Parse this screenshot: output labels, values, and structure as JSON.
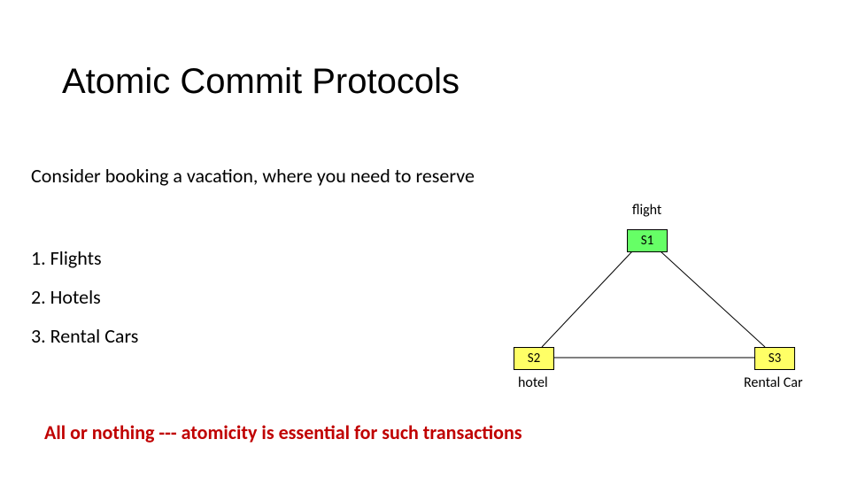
{
  "title": "Atomic Commit Protocols",
  "subtitle": "Consider booking a vacation, where you need to reserve",
  "list": {
    "i1": "1. Flights",
    "i2": "2. Hotels",
    "i3": "3. Rental Cars"
  },
  "conclusion": "All or nothing --- atomicity is essential for such transactions",
  "diagram": {
    "nodes": {
      "s1": "S1",
      "s2": "S2",
      "s3": "S3"
    },
    "labels": {
      "top": "flight",
      "left": "hotel",
      "right": "Rental Car"
    },
    "colors": {
      "s1": "#66ff66",
      "s2": "#ffff66",
      "s3": "#ffff66"
    }
  }
}
